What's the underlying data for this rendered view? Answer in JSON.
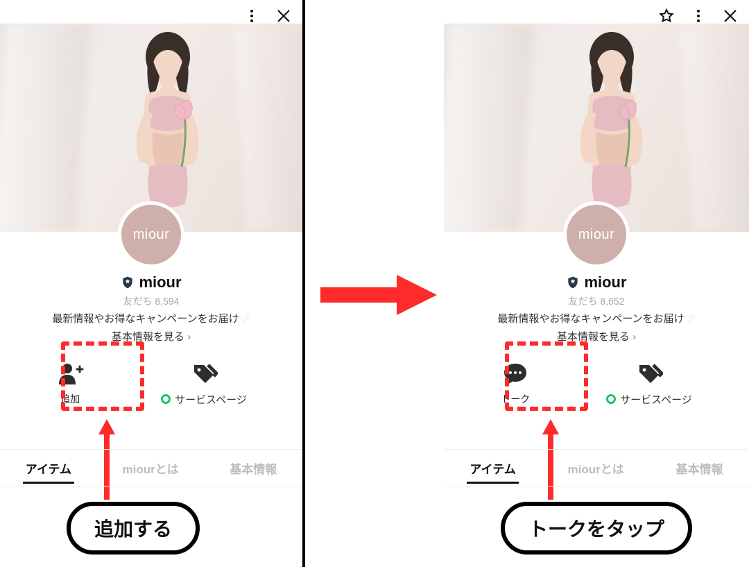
{
  "common": {
    "brand_name": "miour",
    "avatar_text": "miour",
    "friends_prefix": "友だち ",
    "description": "最新情報やお得なキャンペーンをお届け",
    "more_info_label": "基本情報を見る",
    "service_page_label": "サービスページ",
    "tabs": {
      "items": "アイテム",
      "about": "miourとは",
      "basic": "基本情報"
    }
  },
  "left": {
    "friends_count": "8,594",
    "primary_action_label": "追加",
    "caption": "追加する"
  },
  "right": {
    "friends_count": "8,652",
    "primary_action_label": "トーク",
    "caption": "トークをタップ"
  }
}
